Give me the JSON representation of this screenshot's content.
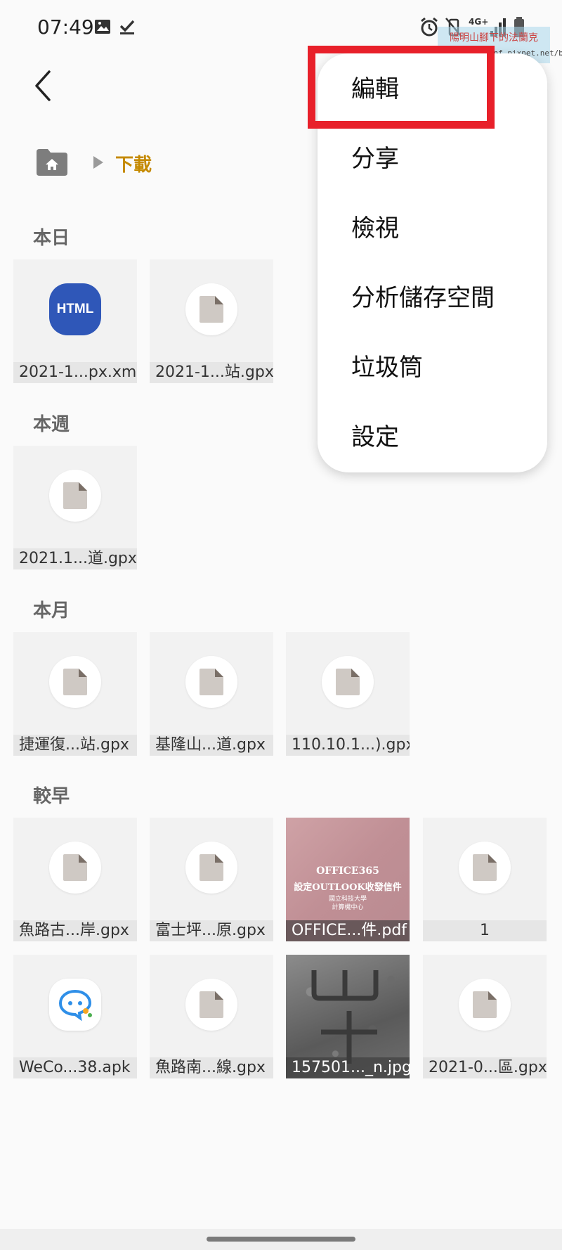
{
  "status_bar": {
    "time": "07:49",
    "network": "4G+",
    "watermark_line1": "陽明山腳下的法蘭克",
    "watermark_line2": "http://ballenf.pixnet.net/blog"
  },
  "breadcrumb": {
    "current": "下載"
  },
  "sections": {
    "today": {
      "title": "本日",
      "files": [
        {
          "name": "2021-1...px.xml",
          "type": "html"
        },
        {
          "name": "2021-1...站.gpx",
          "type": "doc"
        }
      ]
    },
    "this_week": {
      "title": "本週",
      "files": [
        {
          "name": "2021.1...道.gpx",
          "type": "doc"
        }
      ]
    },
    "this_month": {
      "title": "本月",
      "files": [
        {
          "name": "捷運復...站.gpx",
          "type": "doc"
        },
        {
          "name": "基隆山...道.gpx",
          "type": "doc"
        },
        {
          "name": "110.10.1...).gpx",
          "type": "doc"
        }
      ]
    },
    "earlier": {
      "title": "較早",
      "files": [
        {
          "name": "魚路古...岸.gpx",
          "type": "doc"
        },
        {
          "name": "富士坪...原.gpx",
          "type": "doc"
        },
        {
          "name": "OFFICE...件.pdf",
          "type": "pdf"
        },
        {
          "name": "1",
          "type": "doc"
        },
        {
          "name": "WeCo...38.apk",
          "type": "apk"
        },
        {
          "name": "魚路南...線.gpx",
          "type": "doc"
        },
        {
          "name": "157501..._n.jpg",
          "type": "image"
        },
        {
          "name": "2021-0...區.gpx",
          "type": "doc"
        }
      ]
    }
  },
  "html_badge": "HTML",
  "pdf_thumbnail": {
    "line1": "OFFICE365",
    "line2": "設定OUTLOOK收發信件",
    "line3": "國立科技大學",
    "line4": "計算機中心"
  },
  "menu": {
    "items": [
      {
        "label": "編輯"
      },
      {
        "label": "分享"
      },
      {
        "label": "檢視"
      },
      {
        "label": "分析儲存空間"
      },
      {
        "label": "垃圾筒"
      },
      {
        "label": "設定"
      }
    ]
  },
  "colors": {
    "accent": "#c58a00",
    "highlight": "#e8202a",
    "html_badge": "#2f57b8",
    "folder": "#7d7d7d"
  },
  "icons": {
    "back": "chevron-left-icon",
    "home_folder": "home-folder-icon",
    "crumb_arrow": "triangle-right-icon",
    "file": "document-icon"
  }
}
